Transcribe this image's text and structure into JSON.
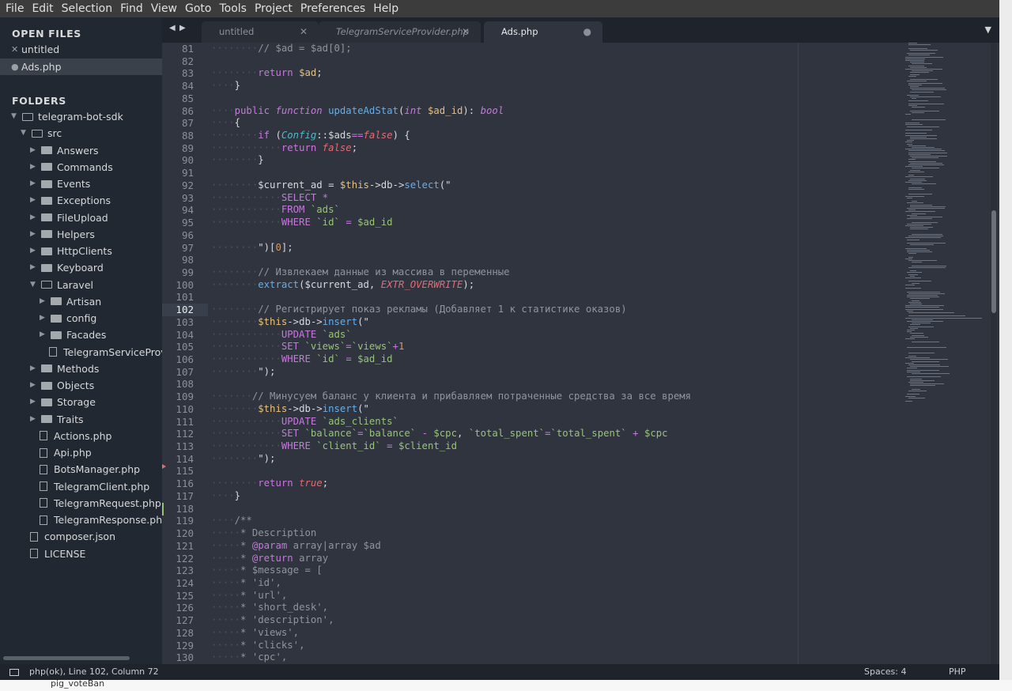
{
  "menubar": [
    "File",
    "Edit",
    "Selection",
    "Find",
    "View",
    "Goto",
    "Tools",
    "Project",
    "Preferences",
    "Help"
  ],
  "sidebar": {
    "open_files_heading": "OPEN FILES",
    "open_files": [
      {
        "label": "untitled",
        "mark": "✕",
        "active": false
      },
      {
        "label": "Ads.php",
        "mark": "●",
        "active": true
      }
    ],
    "folders_heading": "FOLDERS",
    "tree": [
      {
        "label": "telegram-bot-sdk",
        "type": "folder-open",
        "depth": 0
      },
      {
        "label": "src",
        "type": "folder-open",
        "depth": 1
      },
      {
        "label": "Answers",
        "type": "folder",
        "depth": 2
      },
      {
        "label": "Commands",
        "type": "folder",
        "depth": 2
      },
      {
        "label": "Events",
        "type": "folder",
        "depth": 2
      },
      {
        "label": "Exceptions",
        "type": "folder",
        "depth": 2
      },
      {
        "label": "FileUpload",
        "type": "folder",
        "depth": 2
      },
      {
        "label": "Helpers",
        "type": "folder",
        "depth": 2
      },
      {
        "label": "HttpClients",
        "type": "folder",
        "depth": 2
      },
      {
        "label": "Keyboard",
        "type": "folder",
        "depth": 2
      },
      {
        "label": "Laravel",
        "type": "folder-open",
        "depth": 2
      },
      {
        "label": "Artisan",
        "type": "folder",
        "depth": 3
      },
      {
        "label": "config",
        "type": "folder",
        "depth": 3
      },
      {
        "label": "Facades",
        "type": "folder",
        "depth": 3
      },
      {
        "label": "TelegramServiceProvid",
        "type": "file",
        "depth": 3
      },
      {
        "label": "Methods",
        "type": "folder",
        "depth": 2
      },
      {
        "label": "Objects",
        "type": "folder",
        "depth": 2
      },
      {
        "label": "Storage",
        "type": "folder",
        "depth": 2
      },
      {
        "label": "Traits",
        "type": "folder",
        "depth": 2
      },
      {
        "label": "Actions.php",
        "type": "file",
        "depth": 2
      },
      {
        "label": "Api.php",
        "type": "file",
        "depth": 2
      },
      {
        "label": "BotsManager.php",
        "type": "file",
        "depth": 2
      },
      {
        "label": "TelegramClient.php",
        "type": "file",
        "depth": 2
      },
      {
        "label": "TelegramRequest.php",
        "type": "file",
        "depth": 2
      },
      {
        "label": "TelegramResponse.php",
        "type": "file",
        "depth": 2
      },
      {
        "label": "composer.json",
        "type": "file",
        "depth": 1
      },
      {
        "label": "LICENSE",
        "type": "file",
        "depth": 1
      }
    ]
  },
  "tabs": [
    {
      "label": "untitled",
      "close": "✕",
      "active": false,
      "italic": false
    },
    {
      "label": "TelegramServiceProvider.php",
      "close": "✕",
      "active": false,
      "italic": true
    },
    {
      "label": "Ads.php",
      "close": "●",
      "active": true,
      "italic": false
    }
  ],
  "tab_nav": {
    "left": "◀",
    "right": "▶",
    "overflow": "▼"
  },
  "editor": {
    "first_line": 81,
    "current_line": 102,
    "lines": [
      [
        [
          "d",
          "········"
        ],
        [
          "c",
          "// $ad = $ad[0];"
        ]
      ],
      [],
      [
        [
          "d",
          "········"
        ],
        [
          "k",
          "return"
        ],
        [
          "p",
          " "
        ],
        [
          "v",
          "$ad"
        ],
        [
          "p",
          ";"
        ]
      ],
      [
        [
          "d",
          "····"
        ],
        [
          "p",
          "}"
        ]
      ],
      [],
      [
        [
          "d",
          "····"
        ],
        [
          "k",
          "public"
        ],
        [
          "p",
          " "
        ],
        [
          "t",
          "function"
        ],
        [
          "p",
          " "
        ],
        [
          "f",
          "updateAdStat"
        ],
        [
          "p",
          "("
        ],
        [
          "t",
          "int"
        ],
        [
          "p",
          " "
        ],
        [
          "v",
          "$ad_id"
        ],
        [
          "p",
          "): "
        ],
        [
          "t",
          "bool"
        ]
      ],
      [
        [
          "d",
          "····"
        ],
        [
          "p",
          "{"
        ]
      ],
      [
        [
          "d",
          "········"
        ],
        [
          "k",
          "if"
        ],
        [
          "p",
          " ("
        ],
        [
          "cls",
          "Config"
        ],
        [
          "p",
          "::"
        ],
        [
          "p",
          "$ads"
        ],
        [
          "k",
          "=="
        ],
        [
          "con",
          "false"
        ],
        [
          "p",
          ") {"
        ]
      ],
      [
        [
          "d",
          "············"
        ],
        [
          "k",
          "return"
        ],
        [
          "p",
          " "
        ],
        [
          "con",
          "false"
        ],
        [
          "p",
          ";"
        ]
      ],
      [
        [
          "d",
          "········"
        ],
        [
          "p",
          "}"
        ]
      ],
      [],
      [
        [
          "d",
          "········"
        ],
        [
          "p",
          "$current_ad = "
        ],
        [
          "v",
          "$this"
        ],
        [
          "p",
          "->db->"
        ],
        [
          "f",
          "select"
        ],
        [
          "p",
          "(\""
        ]
      ],
      [
        [
          "d",
          "············"
        ],
        [
          "k",
          "SELECT"
        ],
        [
          "p",
          " "
        ],
        [
          "k",
          "*"
        ]
      ],
      [
        [
          "d",
          "············"
        ],
        [
          "k",
          "FROM"
        ],
        [
          "p",
          " "
        ],
        [
          "s",
          "`ads`"
        ]
      ],
      [
        [
          "d",
          "············"
        ],
        [
          "k",
          "WHERE"
        ],
        [
          "p",
          " "
        ],
        [
          "s",
          "`id`"
        ],
        [
          "p",
          " "
        ],
        [
          "k",
          "="
        ],
        [
          "p",
          " "
        ],
        [
          "s",
          "$ad_id"
        ]
      ],
      [],
      [
        [
          "d",
          "········"
        ],
        [
          "p",
          "\")"
        ],
        [
          "p",
          "["
        ],
        [
          "n",
          "0"
        ],
        [
          "p",
          "];"
        ]
      ],
      [],
      [
        [
          "d",
          "········"
        ],
        [
          "c",
          "// Извлекаем данные из массива в переменные"
        ]
      ],
      [
        [
          "d",
          "········"
        ],
        [
          "f",
          "extract"
        ],
        [
          "p",
          "($current_ad, "
        ],
        [
          "con",
          "EXTR_OVERWRITE"
        ],
        [
          "p",
          ");"
        ]
      ],
      [],
      [
        [
          "d",
          "········"
        ],
        [
          "c",
          "// Регистрирует показ рекламы (Добавляет 1 к статистике оказов)"
        ]
      ],
      [
        [
          "d",
          "········"
        ],
        [
          "v",
          "$this"
        ],
        [
          "p",
          "->db->"
        ],
        [
          "f",
          "insert"
        ],
        [
          "p",
          "(\""
        ]
      ],
      [
        [
          "d",
          "············"
        ],
        [
          "k",
          "UPDATE"
        ],
        [
          "p",
          " "
        ],
        [
          "s",
          "`ads`"
        ]
      ],
      [
        [
          "d",
          "············"
        ],
        [
          "k",
          "SET"
        ],
        [
          "p",
          " "
        ],
        [
          "s",
          "`views`"
        ],
        [
          "k",
          "="
        ],
        [
          "s",
          "`views`"
        ],
        [
          "k",
          "+"
        ],
        [
          "n",
          "1"
        ]
      ],
      [
        [
          "d",
          "············"
        ],
        [
          "k",
          "WHERE"
        ],
        [
          "p",
          " "
        ],
        [
          "s",
          "`id`"
        ],
        [
          "p",
          " "
        ],
        [
          "k",
          "="
        ],
        [
          "p",
          " "
        ],
        [
          "s",
          "$ad_id"
        ]
      ],
      [
        [
          "d",
          "········"
        ],
        [
          "p",
          "\");"
        ]
      ],
      [],
      [
        [
          "d",
          "·······"
        ],
        [
          "c",
          "// Минусуем баланс у клиента и прибавляем потраченные средства за все время"
        ]
      ],
      [
        [
          "d",
          "········"
        ],
        [
          "v",
          "$this"
        ],
        [
          "p",
          "->db->"
        ],
        [
          "f",
          "insert"
        ],
        [
          "p",
          "(\""
        ]
      ],
      [
        [
          "d",
          "············"
        ],
        [
          "k",
          "UPDATE"
        ],
        [
          "p",
          " "
        ],
        [
          "s",
          "`ads_clients`"
        ]
      ],
      [
        [
          "d",
          "············"
        ],
        [
          "k",
          "SET"
        ],
        [
          "p",
          " "
        ],
        [
          "s",
          "`balance`"
        ],
        [
          "k",
          "="
        ],
        [
          "s",
          "`balance`"
        ],
        [
          "p",
          " "
        ],
        [
          "k",
          "-"
        ],
        [
          "p",
          " "
        ],
        [
          "s",
          "$cpc"
        ],
        [
          "p",
          ", "
        ],
        [
          "s",
          "`total_spent`"
        ],
        [
          "k",
          "="
        ],
        [
          "s",
          "`total_spent`"
        ],
        [
          "p",
          " "
        ],
        [
          "k",
          "+"
        ],
        [
          "p",
          " "
        ],
        [
          "s",
          "$cpc"
        ]
      ],
      [
        [
          "d",
          "············"
        ],
        [
          "k",
          "WHERE"
        ],
        [
          "p",
          " "
        ],
        [
          "s",
          "`client_id`"
        ],
        [
          "p",
          " "
        ],
        [
          "k",
          "="
        ],
        [
          "p",
          " "
        ],
        [
          "s",
          "$client_id"
        ]
      ],
      [
        [
          "d",
          "········"
        ],
        [
          "p",
          "\");"
        ]
      ],
      [],
      [
        [
          "d",
          "········"
        ],
        [
          "k",
          "return"
        ],
        [
          "p",
          " "
        ],
        [
          "con",
          "true"
        ],
        [
          "p",
          ";"
        ]
      ],
      [
        [
          "d",
          "····"
        ],
        [
          "p",
          "}"
        ]
      ],
      [],
      [
        [
          "d",
          "····"
        ],
        [
          "c",
          "/**"
        ]
      ],
      [
        [
          "d",
          "·····"
        ],
        [
          "c",
          "* Description"
        ]
      ],
      [
        [
          "d",
          "·····"
        ],
        [
          "c",
          "* "
        ],
        [
          "k",
          "@param"
        ],
        [
          "c",
          " array|array $ad"
        ]
      ],
      [
        [
          "d",
          "·····"
        ],
        [
          "c",
          "* "
        ],
        [
          "k",
          "@return"
        ],
        [
          "c",
          " array"
        ]
      ],
      [
        [
          "d",
          "·····"
        ],
        [
          "c",
          "* $message = ["
        ]
      ],
      [
        [
          "d",
          "·····"
        ],
        [
          "c",
          "* 'id',"
        ]
      ],
      [
        [
          "d",
          "·····"
        ],
        [
          "c",
          "* 'url',"
        ]
      ],
      [
        [
          "d",
          "·····"
        ],
        [
          "c",
          "* 'short_desk',"
        ]
      ],
      [
        [
          "d",
          "·····"
        ],
        [
          "c",
          "* 'description',"
        ]
      ],
      [
        [
          "d",
          "·····"
        ],
        [
          "c",
          "* 'views',"
        ]
      ],
      [
        [
          "d",
          "·····"
        ],
        [
          "c",
          "* 'clicks',"
        ]
      ],
      [
        [
          "d",
          "·····"
        ],
        [
          "c",
          "* 'cpc',"
        ]
      ]
    ]
  },
  "status": {
    "left": "php(ok), Line 102, Column 72",
    "spaces": "Spaces: 4",
    "syntax": "PHP"
  },
  "background": {
    "bottom_label": "pig_voteBan"
  }
}
